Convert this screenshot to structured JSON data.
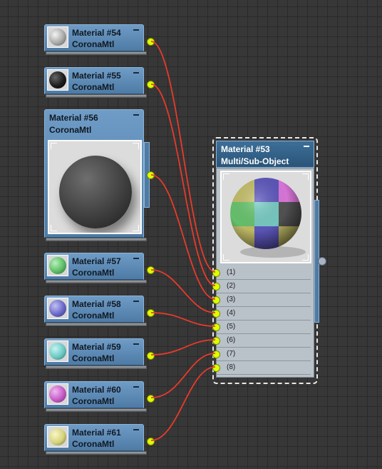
{
  "nodes": [
    {
      "title": "Material #54",
      "type": "CoronaMtl",
      "swatch": "#a8a8a8"
    },
    {
      "title": "Material #55",
      "type": "CoronaMtl",
      "swatch": "#1c1c1c"
    },
    {
      "title": "Material #56",
      "type": "CoronaMtl",
      "swatch": "#4a4a4a"
    },
    {
      "title": "Material #57",
      "type": "CoronaMtl",
      "swatch": "#5cbc64"
    },
    {
      "title": "Material #58",
      "type": "CoronaMtl",
      "swatch": "#6a68c8"
    },
    {
      "title": "Material #59",
      "type": "CoronaMtl",
      "swatch": "#6cc8c4"
    },
    {
      "title": "Material #60",
      "type": "CoronaMtl",
      "swatch": "#c45ac6"
    },
    {
      "title": "Material #61",
      "type": "CoronaMtl",
      "swatch": "#d4d27a"
    }
  ],
  "multi": {
    "title": "Material #53",
    "type": "Multi/Sub-Object",
    "slots": [
      "(1)",
      "(2)",
      "(3)",
      "(4)",
      "(5)",
      "(6)",
      "(7)",
      "(8)"
    ],
    "checker_colors": [
      "#c8c26a",
      "#5e58c0",
      "#e07ae0",
      "#6ac870",
      "#7ad0c8",
      "#545454",
      "#c8c26a",
      "#5e58c0"
    ]
  },
  "colors": {
    "wire": "#e83a2a",
    "socket": "#ddff00",
    "header": "#5b88b4"
  }
}
